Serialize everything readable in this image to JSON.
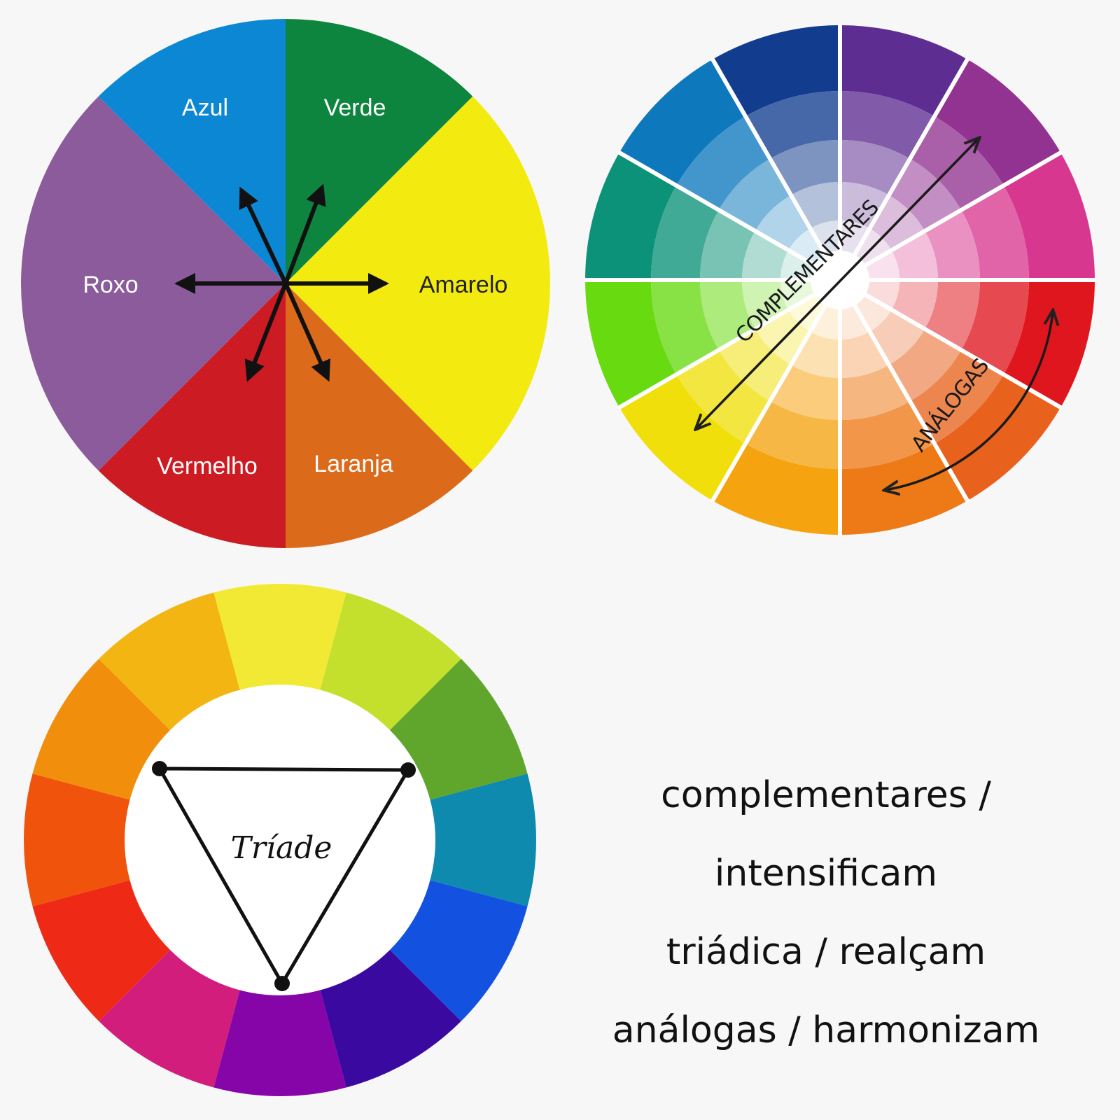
{
  "wheel1": {
    "labels": {
      "azul": "Azul",
      "verde": "Verde",
      "roxo": "Roxo",
      "amarelo": "Amarelo",
      "vermelho": "Vermelho",
      "laranja": "Laranja"
    },
    "colors": {
      "azul": "#0c87d4",
      "verde": "#0e853e",
      "amarelo": "#f3ea10",
      "laranja": "#dc6a1b",
      "vermelho": "#cc1b22",
      "roxo": "#8b5b9c"
    }
  },
  "wheel2": {
    "complementary_label": "COMPLEMENTARES",
    "analogous_label": "ANÁLOGAS",
    "segment_colors": [
      "#5e2d91",
      "#923291",
      "#d8378f",
      "#e0161e",
      "#e8621d",
      "#ee7a17",
      "#f5a30f",
      "#f0df0b",
      "#68da10",
      "#0c9279",
      "#0e78bc",
      "#123d8f"
    ]
  },
  "wheel3": {
    "triad_label": "Tríade",
    "segment_colors": [
      "#f2e934",
      "#c4e02c",
      "#61a62c",
      "#0e8aaf",
      "#1352e1",
      "#3a0aa0",
      "#8505a8",
      "#d21d7d",
      "#ee2a17",
      "#f0540c",
      "#f18e0b",
      "#f2b511"
    ]
  },
  "captions": [
    "complementares / intensificam",
    "triádica / realçam",
    "análogas / harmonizam"
  ]
}
